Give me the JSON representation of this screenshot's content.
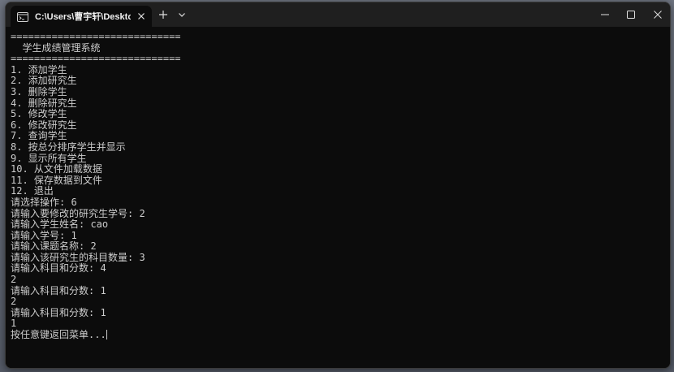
{
  "window": {
    "tab_title": "C:\\Users\\曹宇轩\\Desktop\\sco",
    "icons": {
      "tab": "terminal-icon",
      "tab_close": "close-icon",
      "new_tab": "plus-icon",
      "dropdown": "chevron-down-icon",
      "minimize": "minimize-icon",
      "maximize": "maximize-icon",
      "close": "close-icon"
    }
  },
  "console": {
    "text_color": "#cccccc",
    "background": "#0c0c0c",
    "lines": [
      "=============================",
      "  学生成绩管理系统",
      "=============================",
      "1. 添加学生",
      "2. 添加研究生",
      "3. 删除学生",
      "4. 删除研究生",
      "5. 修改学生",
      "6. 修改研究生",
      "7. 查询学生",
      "8. 按总分排序学生并显示",
      "9. 显示所有学生",
      "10. 从文件加载数据",
      "11. 保存数据到文件",
      "12. 退出",
      "请选择操作: 6",
      "请输入要修改的研究生学号: 2",
      "请输入学生姓名: cao",
      "请输入学号: 1",
      "请输入课题名称: 2",
      "请输入该研究生的科目数量: 3",
      "请输入科目和分数: 4",
      "2",
      "请输入科目和分数: 1",
      "2",
      "请输入科目和分数: 1",
      "1",
      "按任意键返回菜单..."
    ]
  }
}
